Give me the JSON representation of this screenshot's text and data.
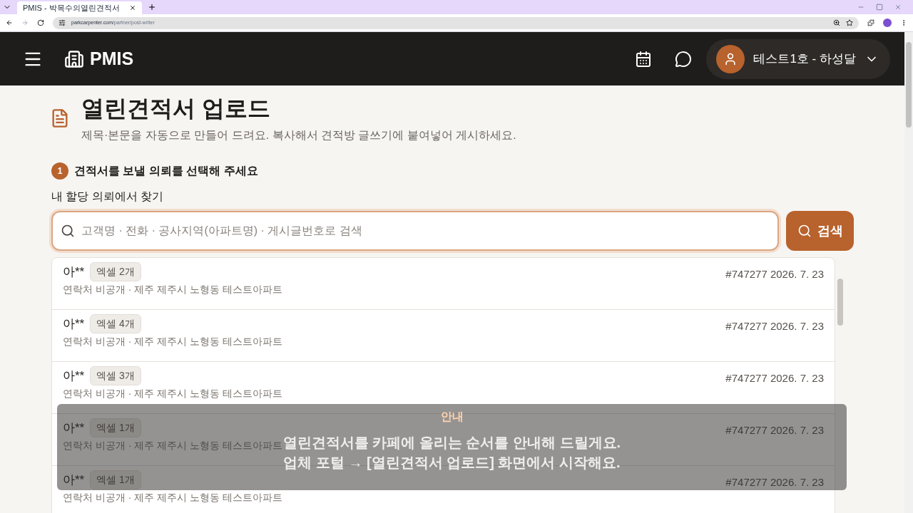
{
  "browser": {
    "tab_title": "PMIS - 박목수의열린견적서",
    "url_host": "parkcarpenter.com",
    "url_path": "/partner/post-writer"
  },
  "header": {
    "brand": "PMIS",
    "user": "테스트1호 - 하성달"
  },
  "page": {
    "title": "열린견적서 업로드",
    "subtitle": "제목·본문을 자동으로 만들어 드려요. 복사해서 견적방 글쓰기에 붙여넣어 게시하세요.",
    "step_number": "1",
    "step_label": "견적서를 보낼 의뢰를 선택해 주세요",
    "search_label": "내 할당 의뢰에서 찾기",
    "search_placeholder": "고객명 · 전화 · 공사지역(아파트명) · 게시글번호로 검색",
    "search_button": "검색"
  },
  "results": [
    {
      "name": "아**",
      "badge": "엑셀 2개",
      "detail": "연락처 비공개 · 제주 제주시 노형동 테스트아파트",
      "meta": "#747277 2026. 7. 23"
    },
    {
      "name": "아**",
      "badge": "엑셀 4개",
      "detail": "연락처 비공개 · 제주 제주시 노형동 테스트아파트",
      "meta": "#747277 2026. 7. 23"
    },
    {
      "name": "아**",
      "badge": "엑셀 3개",
      "detail": "연락처 비공개 · 제주 제주시 노형동 테스트아파트",
      "meta": "#747277 2026. 7. 23"
    },
    {
      "name": "아**",
      "badge": "엑셀 1개",
      "detail": "연락처 비공개 · 제주 제주시 노형동 테스트아파트",
      "meta": "#747277 2026. 7. 23"
    },
    {
      "name": "아**",
      "badge": "엑셀 1개",
      "detail": "연락처 비공개 · 제주 제주시 노형동 테스트아파트",
      "meta": "#747277 2026. 7. 23"
    }
  ],
  "notice": {
    "title": "안내",
    "lines": [
      "열린견적서를 카페에 올리는 순서를 안내해 드릴게요.",
      "업체 포털 → [열린견적서 업로드] 화면에서 시작해요."
    ]
  }
}
